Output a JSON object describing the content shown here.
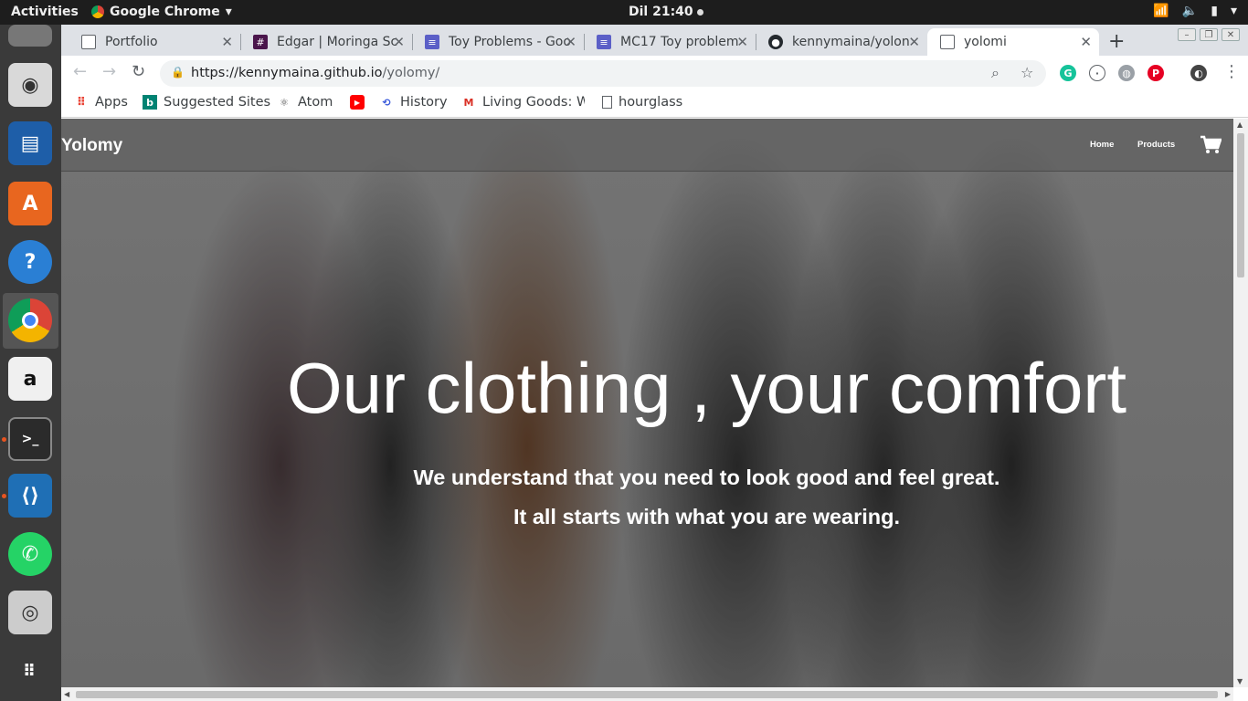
{
  "system": {
    "activities": "Activities",
    "app_menu": "Google Chrome",
    "clock": "Dil 21:40"
  },
  "browser": {
    "tabs": [
      {
        "title": "Portfolio",
        "icon": "page-icon"
      },
      {
        "title": "Edgar | Moringa Sc",
        "icon": "slack-icon"
      },
      {
        "title": "Toy Problems - Goo",
        "icon": "google-docs-icon"
      },
      {
        "title": "MC17 Toy problem",
        "icon": "google-docs-icon"
      },
      {
        "title": "kennymaina/yolon",
        "icon": "github-icon"
      },
      {
        "title": "yolomi",
        "icon": "page-icon",
        "active": true
      }
    ],
    "url_host": "https://kennymaina.github.io",
    "url_path": "/yolomy/",
    "bookmarks": [
      {
        "label": "Apps",
        "icon": "apps-grid-icon"
      },
      {
        "label": "Suggested Sites",
        "icon": "bing-icon"
      },
      {
        "label": "Atom",
        "icon": "atom-icon"
      },
      {
        "label": "",
        "icon": "youtube-icon"
      },
      {
        "label": "History",
        "icon": "history-icon"
      },
      {
        "label": "Living Goods: W",
        "icon": "gmail-icon"
      },
      {
        "label": "hourglass",
        "icon": "page-icon"
      }
    ]
  },
  "site": {
    "brand": "Yolomy",
    "nav": {
      "home": "Home",
      "products": "Products"
    },
    "headline": "Our clothing , your comfort",
    "tagline_1": "We understand that you need to look good and feel great.",
    "tagline_2": "It all starts with what you are wearing."
  }
}
